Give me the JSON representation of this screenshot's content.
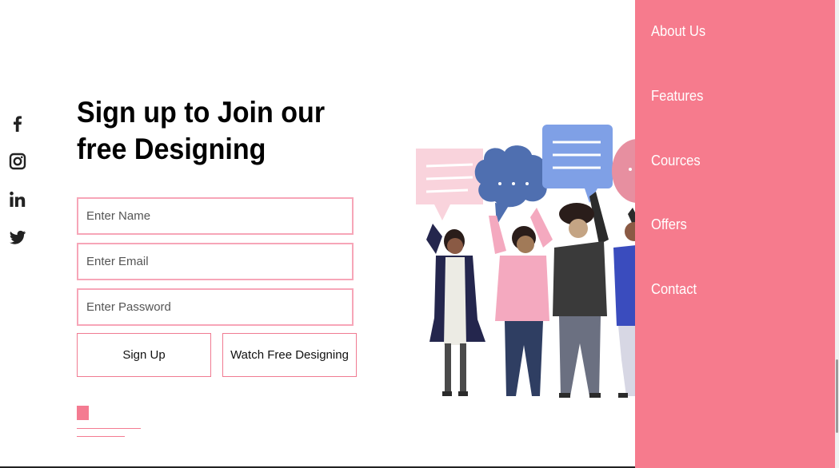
{
  "social": {
    "icons": [
      "facebook-icon",
      "instagram-icon",
      "linkedin-icon",
      "twitter-icon"
    ]
  },
  "form": {
    "title_line1": "Sign up to Join our",
    "title_line2": "free Designing",
    "name_placeholder": "Enter Name",
    "email_placeholder": "Enter Email",
    "password_placeholder": "Enter Password",
    "signup_label": "Sign Up",
    "watch_label": "Watch Free Designing"
  },
  "nav": {
    "items": [
      "About Us",
      "Features",
      "Cources",
      "Offers",
      "Contact"
    ]
  },
  "colors": {
    "accent": "#f67b8d",
    "field_border": "#f7a6b8"
  }
}
